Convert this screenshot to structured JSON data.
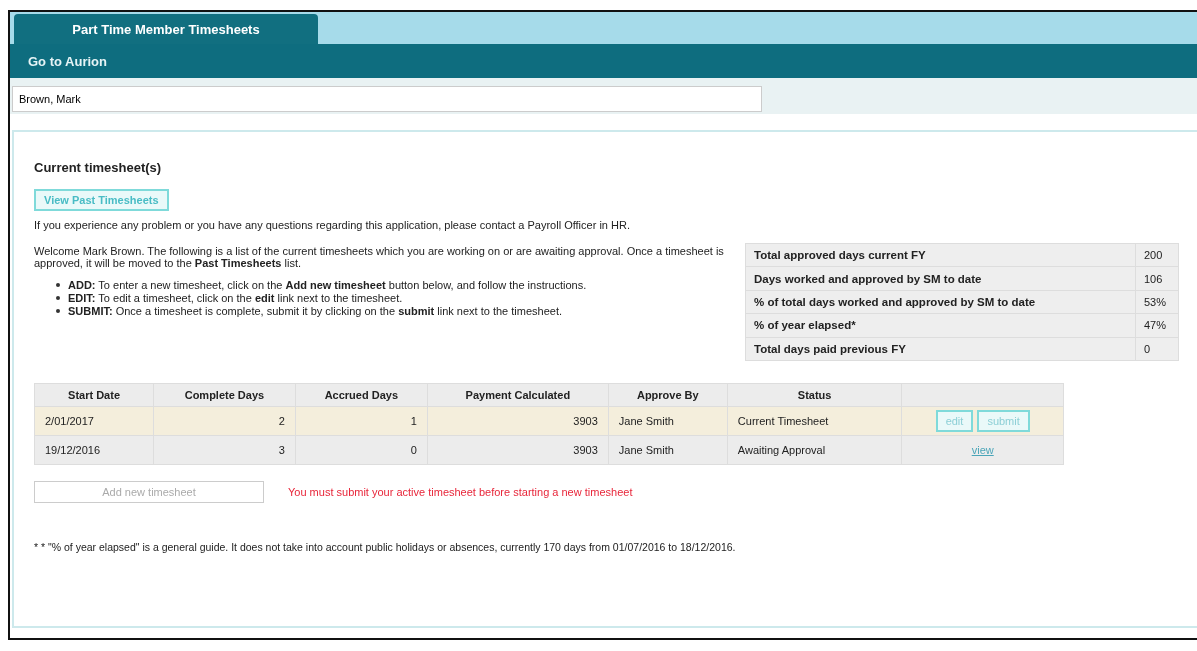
{
  "tabs": [
    {
      "label": "Part Time Member Timesheets",
      "selected": true
    }
  ],
  "nav": {
    "link": "Go to Aurion"
  },
  "employee_field": {
    "value": "Brown, Mark"
  },
  "section": {
    "title": "Current timesheet(s)",
    "past_button": "View Past Timesheets",
    "help_text": "If you experience any problem or you have any questions regarding this application, please contact a Payroll Officer in HR.",
    "intro": "Welcome Mark Brown. The following is a list of the current timesheets which you are working on or are awaiting approval. Once a timesheet is approved, it will be moved to the **Past Timesheets** list.",
    "bullets": [
      "**ADD:** To enter a new timesheet, click on the **Add new timesheet** button below, and follow the instructions.",
      "**EDIT:** To edit a timesheet, click on the **edit** link next to the timesheet.",
      "**SUBMIT:** Once a timesheet is complete, submit it by clicking on the **submit** link next to the timesheet."
    ]
  },
  "summary": [
    {
      "label": "Total approved days current FY",
      "value": "200"
    },
    {
      "label": "Days worked and approved by SM to date",
      "value": "106"
    },
    {
      "label": "% of total days worked and approved by SM to date",
      "value": "53%"
    },
    {
      "label": "% of year elapsed*",
      "value": "47%"
    },
    {
      "label": "Total days paid previous FY",
      "value": "0"
    }
  ],
  "table": {
    "columns": [
      "Start Date",
      "Complete Days",
      "Accrued Days",
      "Payment Calculated",
      "Approve By",
      "Status"
    ],
    "rows": [
      {
        "selected": true,
        "cells": [
          "2/01/2017",
          "2",
          "1",
          "3903",
          "Jane Smith",
          "Current Timesheet"
        ],
        "actions": [
          {
            "kind": "button",
            "label": "edit"
          },
          {
            "kind": "button",
            "label": "submit"
          }
        ]
      },
      {
        "selected": false,
        "cells": [
          "19/12/2016",
          "3",
          "0",
          "3903",
          "Jane Smith",
          "Awaiting Approval"
        ],
        "actions": [
          {
            "kind": "link",
            "label": "view"
          }
        ]
      }
    ]
  },
  "add_button": {
    "label": "Add new timesheet",
    "disabled": true
  },
  "warning": "You must submit your active timesheet before starting a new timesheet",
  "footnote": "* * \"% of year elapsed\" is a general guide. It does not take into account public holidays or absences, currently 170 days from 01/07/2016 to 18/12/2016."
}
